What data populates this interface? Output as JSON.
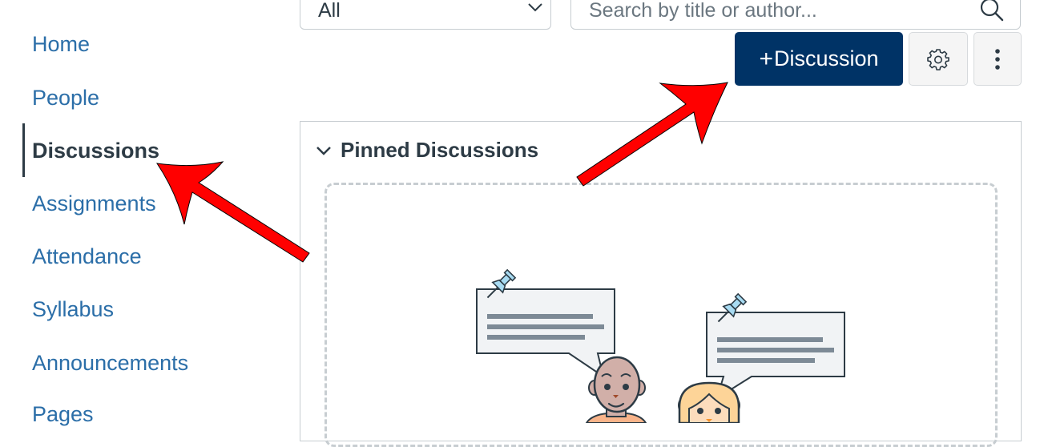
{
  "sidebar": {
    "items": [
      {
        "label": "Home",
        "active": false
      },
      {
        "label": "People",
        "active": false
      },
      {
        "label": "Discussions",
        "active": true
      },
      {
        "label": "Assignments",
        "active": false
      },
      {
        "label": "Attendance",
        "active": false
      },
      {
        "label": "Syllabus",
        "active": false
      },
      {
        "label": "Announcements",
        "active": false
      },
      {
        "label": "Pages",
        "active": false
      }
    ]
  },
  "filters": {
    "select_value": "All",
    "search_placeholder": "Search by title or author..."
  },
  "toolbar": {
    "add_discussion_plus": "+",
    "add_discussion_label": "Discussion",
    "settings_icon": "gear-icon",
    "more_icon": "kebab-icon"
  },
  "pinned": {
    "title": "Pinned Discussions",
    "expanded": true
  },
  "annotations": {
    "arrow_color": "#ff0000",
    "arrows": [
      "points-to-discussions-nav",
      "points-to-add-discussion-button"
    ]
  },
  "colors": {
    "brand_primary": "#003366",
    "link": "#2b6ea8",
    "text": "#2d3b45"
  }
}
